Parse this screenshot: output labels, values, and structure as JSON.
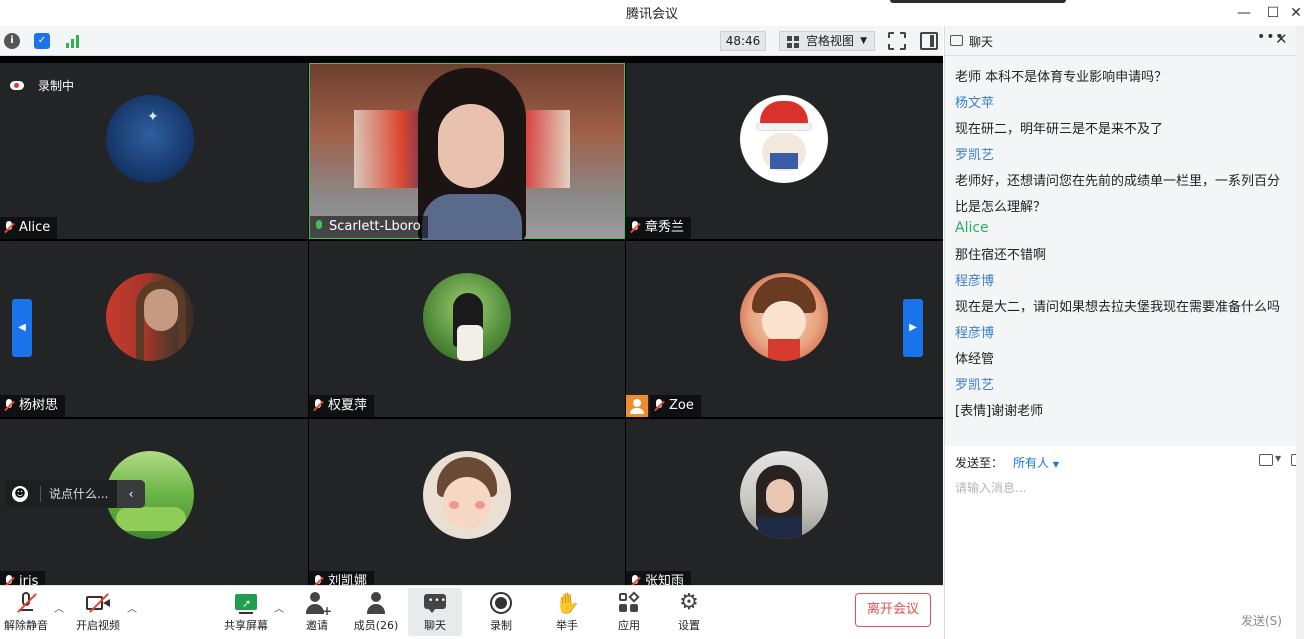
{
  "window": {
    "title": "腾讯会议"
  },
  "infobar": {
    "timer": "48:46",
    "view_label": "宫格视图"
  },
  "recording": {
    "label": "录制中"
  },
  "participants": [
    {
      "name": "Alice",
      "mic": "muted"
    },
    {
      "name": "Scarlett-Lboro",
      "mic": "on"
    },
    {
      "name": "章秀兰",
      "mic": "muted"
    },
    {
      "name": "杨树思",
      "mic": "muted"
    },
    {
      "name": "权夏萍",
      "mic": "muted"
    },
    {
      "name": "Zoe",
      "mic": "muted"
    },
    {
      "name": "iris",
      "mic": "muted"
    },
    {
      "name": "刘凯娜",
      "mic": "muted"
    },
    {
      "name": "张知雨",
      "mic": "muted"
    }
  ],
  "say_something": {
    "placeholder": "说点什么..."
  },
  "toolbar": {
    "unmute": "解除静音",
    "start_video": "开启视频",
    "share_screen": "共享屏幕",
    "invite": "邀请",
    "members": "成员(26)",
    "chat": "聊天",
    "record": "录制",
    "raise_hand": "举手",
    "apps": "应用",
    "settings": "设置",
    "leave": "离开会议"
  },
  "chat": {
    "title": "聊天",
    "messages": [
      {
        "kind": "text",
        "text": "老师 本科不是体育专业影响申请吗？"
      },
      {
        "kind": "sender",
        "text": "杨文苹"
      },
      {
        "kind": "text",
        "text": "现在研二，明年研三是不是来不及了"
      },
      {
        "kind": "sender",
        "text": "罗凯艺"
      },
      {
        "kind": "text",
        "text": "老师好，还想请问您在先前的成绩单一栏里，一系列百分"
      },
      {
        "kind": "text",
        "text": "比是怎么理解？"
      },
      {
        "kind": "sender-green",
        "text": "Alice"
      },
      {
        "kind": "text",
        "text": "那住宿还不错啊"
      },
      {
        "kind": "sender",
        "text": "程彦博"
      },
      {
        "kind": "text",
        "text": "现在是大二，请问如果想去拉夫堡我现在需要准备什么吗"
      },
      {
        "kind": "sender",
        "text": "程彦博"
      },
      {
        "kind": "text",
        "text": "体经管"
      },
      {
        "kind": "sender",
        "text": "罗凯艺"
      },
      {
        "kind": "text",
        "text": "[表情]谢谢老师"
      }
    ],
    "send_to_label": "发送至：",
    "send_to_target": "所有人",
    "input_placeholder": "请输入消息...",
    "send_label": "发送(S)"
  },
  "colors": {
    "accent": "#1a73e8",
    "leave": "#e3524d",
    "tile_bg": "#232426"
  }
}
